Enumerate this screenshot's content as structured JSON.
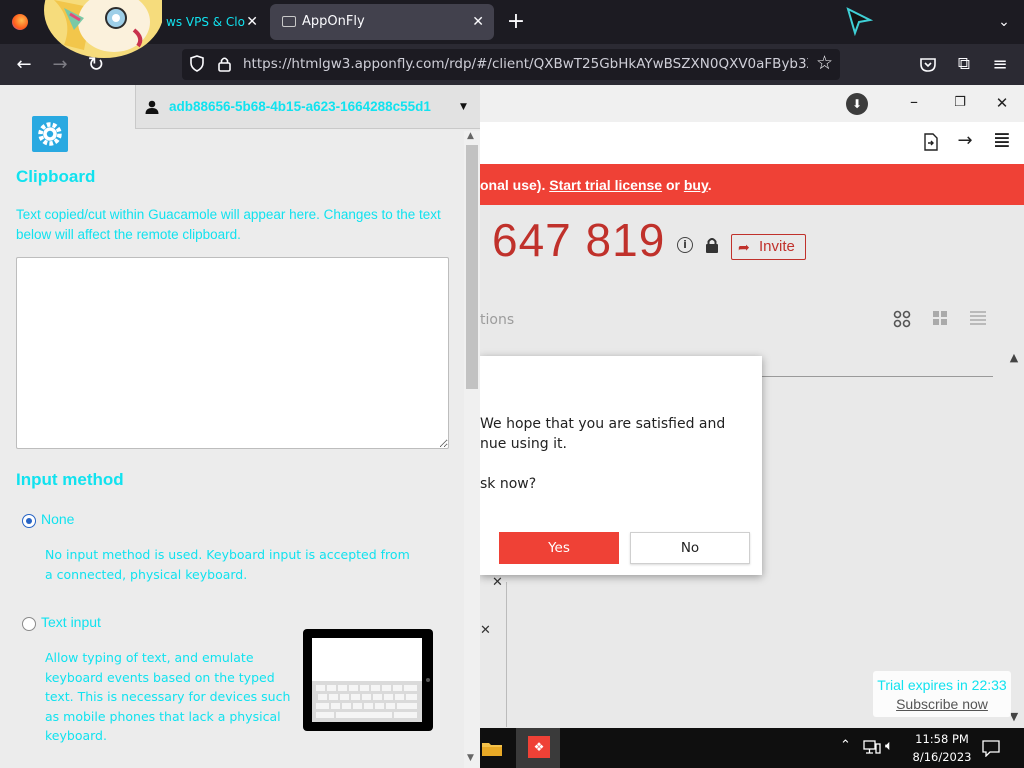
{
  "browser": {
    "tabs": [
      {
        "label": "ws VPS & Clo"
      },
      {
        "label": "AppOnFly"
      }
    ],
    "url": "https://htmlgw3.apponfly.com/rdp/#/client/QXBwT25GbHkAYwBSZXN0QXV0aFByb3ZpZGVy"
  },
  "guacamole": {
    "username": "adb88656-5b68-4b15-a623-1664288c55d1",
    "clipboard_title": "Clipboard",
    "clipboard_desc": "Text copied/cut within Guacamole will appear here. Changes to the text below will affect the remote clipboard.",
    "clipboard_value": "",
    "input_method_title": "Input method",
    "options": [
      {
        "label": "None",
        "desc": "No input method is used. Keyboard input is accepted from a connected, physical keyboard.",
        "selected": true
      },
      {
        "label": "Text input",
        "desc": "Allow typing of text, and emulate keyboard events based on the typed text. This is necessary for devices such as mobile phones that lack a physical keyboard.",
        "selected": false
      }
    ]
  },
  "remote": {
    "banner_text": "onal use). ",
    "banner_link1": "Start trial license",
    "banner_or": " or ",
    "banner_link2": "buy",
    "banner_end": ".",
    "id_number": "647 819",
    "invite_label": "Invite",
    "faded_text": "tions",
    "dialog": {
      "line1": "We hope that you are satisfied and",
      "line2": "nue using it.",
      "line3": "sk now?",
      "yes": "Yes",
      "no": "No"
    },
    "trial_text": "Trial expires in 22:33",
    "subscribe_label": "Subscribe now",
    "clock_time": "11:58 PM",
    "clock_date": "8/16/2023"
  },
  "colors": {
    "accent_red": "#ef4136",
    "guac_cyan": "#11e2ef",
    "chrome_dark": "#1c1b22"
  }
}
